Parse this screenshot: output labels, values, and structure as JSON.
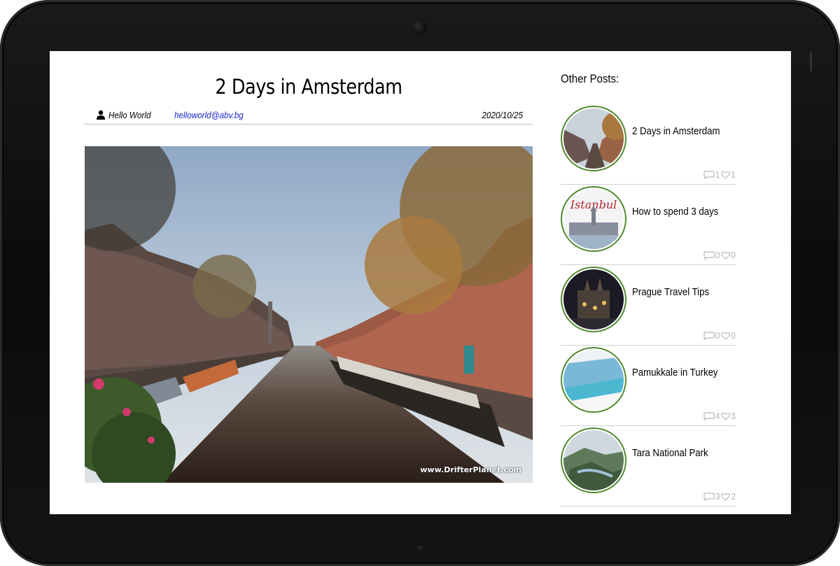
{
  "article": {
    "title": "2 Days in Amsterdam",
    "author": "Hello World",
    "email": "helloworld@abv.bg",
    "date": "2020/10/25",
    "image_watermark": "www.DrifterPlanet.com",
    "icons": {
      "author": "user-icon"
    }
  },
  "sidebar": {
    "heading": "Other Posts:",
    "posts": [
      {
        "title": "2 Days in Amsterdam",
        "comments": "1",
        "likes": "1"
      },
      {
        "title": "How to spend 3 days",
        "comments": "0",
        "likes": "0",
        "thumb_text": "Istanbul"
      },
      {
        "title": "Prague Travel Tips",
        "comments": "0",
        "likes": "0"
      },
      {
        "title": "Pamukkale in Turkey",
        "comments": "4",
        "likes": "3"
      },
      {
        "title": "Tara National Park",
        "comments": "3",
        "likes": "2"
      }
    ],
    "icons": {
      "comments": "comment-icon",
      "likes": "heart-icon"
    }
  },
  "colors": {
    "thumb_border": "#4f8a2d",
    "email_link": "#1a25c9",
    "stats": "#b8b8b8"
  }
}
